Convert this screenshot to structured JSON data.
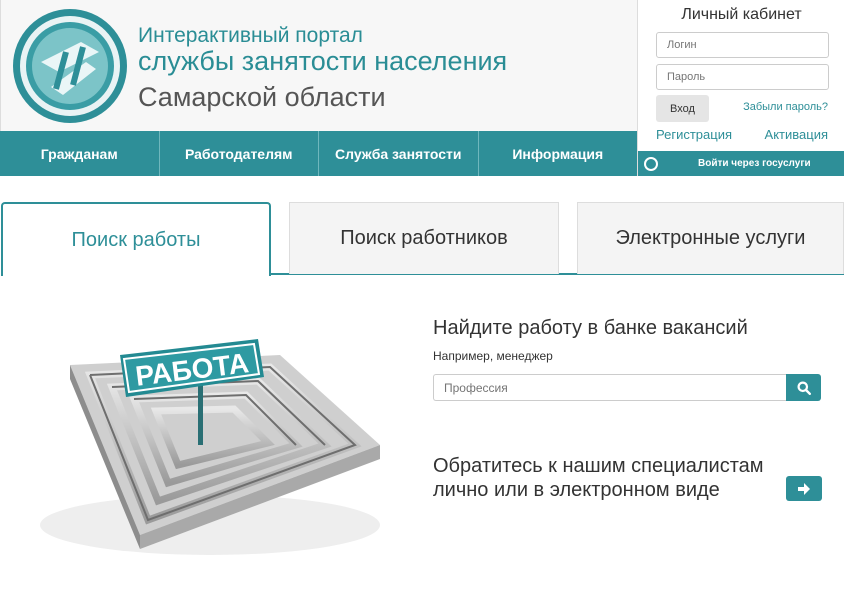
{
  "header": {
    "title_line1": "Интерактивный портал",
    "title_line2": "службы занятости населения",
    "title_line3": "Самарской области"
  },
  "nav": {
    "items": [
      "Гражданам",
      "Работодателям",
      "Служба занятости",
      "Информация"
    ]
  },
  "login": {
    "title": "Личный кабинет",
    "login_placeholder": "Логин",
    "password_placeholder": "Пароль",
    "submit_label": "Вход",
    "forgot_label": "Забыли пароль?",
    "register_label": "Регистрация",
    "activate_label": "Активация",
    "gosuslugi_label": "Войти через госуслуги"
  },
  "tabs": {
    "items": [
      "Поиск работы",
      "Поиск работников",
      "Электронные услуги"
    ],
    "active": "Поиск работы"
  },
  "maze": {
    "sign_text": "РАБОТА"
  },
  "search": {
    "title": "Найдите работу в банке вакансий",
    "example": "Например, менеджер",
    "placeholder": "Профессия"
  },
  "contact": {
    "line1": "Обратитесь к нашим специалистам",
    "line2": "лично или в электронном виде"
  },
  "colors": {
    "accent": "#2e8f98",
    "header_bg": "#f7f7f7",
    "text_dark": "#333333",
    "title_gray": "#555555"
  },
  "icons": {
    "search_button": "search-icon",
    "contact_button": "arrow-right-icon",
    "logo": "logo-emblem-icon"
  }
}
